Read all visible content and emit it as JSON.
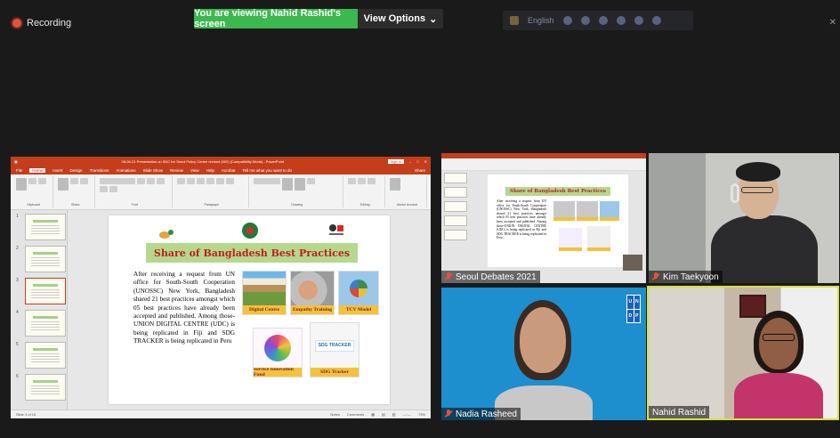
{
  "top": {
    "recording_label": "Recording",
    "viewing_banner": "You are viewing Nahid Rashid's screen",
    "view_options_label": "View Options",
    "view_options_chevron": "⌄",
    "language_label": "English"
  },
  "ppt": {
    "window_title": "08-06-21 Presentation on SDC for Seoul Policy Centre revised (002) [Compatibility Mode] - PowerPoint",
    "sign_in": "Sign in",
    "tabs": [
      "File",
      "Home",
      "Insert",
      "Design",
      "Transitions",
      "Animations",
      "Slide Show",
      "Review",
      "View",
      "Help",
      "Acrobat",
      "Tell me what you want to do"
    ],
    "share_label": "Share",
    "ribbon_groups": [
      "Clipboard",
      "Slides",
      "Font",
      "Paragraph",
      "Drawing",
      "Editing",
      "Adobe Acrobat"
    ],
    "thumb_numbers": [
      "1",
      "2",
      "3",
      "4",
      "5",
      "6"
    ],
    "status_slide": "Slide 3 of 15",
    "status_notes": "Notes",
    "status_comments": "Comments",
    "zoom": "73%"
  },
  "slide": {
    "title": "Share of Bangladesh Best Practices",
    "body": "After receiving a request from UN office for South-South Cooperation (UNOSSC) New York, Bangladesh shared 21 best practices amongst which 05 best practices have already been accepted and published. Among those-UNION DIGITAL CENTRE (UDC) is being replicated in Fiji and SDG TRACKER is being replicated in Peru",
    "captions": {
      "digital_centre": "Digital Centre",
      "empathy_training": "Empathy Training",
      "tcv_model": "TCV Model",
      "service_innovation_fund": "Service Innovation Fund",
      "sdg_tracker": "SDG Tracker"
    },
    "sdg_logo_text": "SDG TRACKER"
  },
  "participants": {
    "tile1_name": "Seoul Debates 2021",
    "tile2_name": "Kim Taekyoon",
    "tile3_name": "Nadia Rasheed",
    "tile4_name": "Nahid Rashid"
  },
  "undp_letters": [
    "U",
    "N",
    "D",
    "P"
  ],
  "colors": {
    "banner_green": "#3bb84f",
    "ppt_red": "#c43e1c",
    "slide_title_bg": "#b5d88f",
    "slide_title_text": "#c41c1c",
    "active_speaker_border": "#d6e23a",
    "mic_muted": "#e8503a"
  }
}
